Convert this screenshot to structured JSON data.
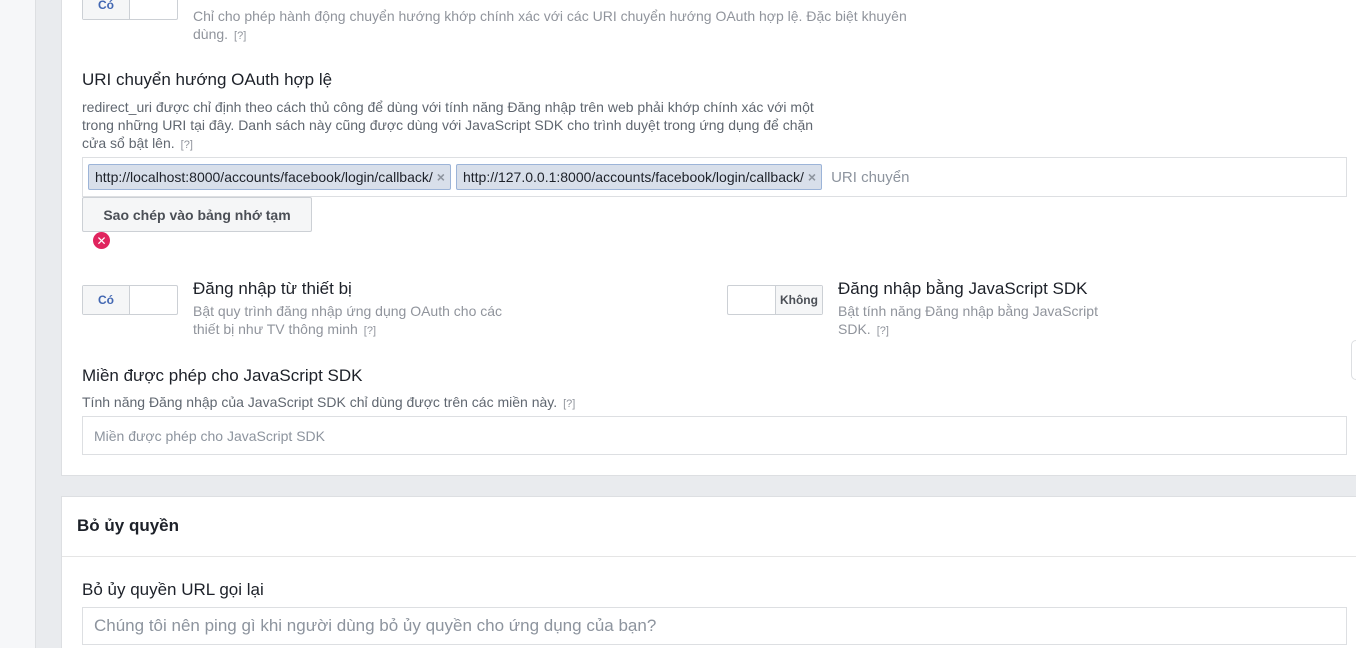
{
  "strict_mode": {
    "toggle_on_label": "Có",
    "desc": "Chỉ cho phép hành động chuyển hướng khớp chính xác với các URI chuyển hướng OAuth hợp lệ. Đặc biệt khuyên dùng."
  },
  "help_marker": "[?]",
  "redirect_uris": {
    "label": "URI chuyển hướng OAuth hợp lệ",
    "desc": "redirect_uri được chỉ định theo cách thủ công để dùng với tính năng Đăng nhập trên web phải khớp chính xác với một trong những URI tại đây. Danh sách này cũng được dùng với JavaScript SDK cho trình duyệt trong ứng dụng để chặn cửa sổ bật lên.",
    "tags": [
      "http://localhost:8000/accounts/facebook/login/callback/",
      "http://127.0.0.1:8000/accounts/facebook/login/callback/"
    ],
    "input_placeholder": "URI chuyển",
    "copy_button": "Sao chép vào bảng nhớ tạm",
    "error_icon_name": "error-x-icon"
  },
  "device_login": {
    "toggle_on_label": "Có",
    "title": "Đăng nhập từ thiết bị",
    "desc": "Bật quy trình đăng nhập ứng dụng OAuth cho các thiết bị như TV thông minh"
  },
  "js_sdk_login": {
    "toggle_off_label": "Không",
    "title": "Đăng nhập bằng JavaScript SDK",
    "desc": "Bật tính năng Đăng nhập bằng JavaScript SDK."
  },
  "js_domains": {
    "label": "Miền được phép cho JavaScript SDK",
    "desc": "Tính năng Đăng nhập của JavaScript SDK chỉ dùng được trên các miền này.",
    "placeholder": "Miền được phép cho JavaScript SDK"
  },
  "deauthorize": {
    "heading": "Bỏ ủy quyền",
    "callback_label": "Bỏ ủy quyền URL gọi lại",
    "callback_placeholder": "Chúng tôi nên ping gì khi người dùng bỏ ủy quyền cho ứng dụng của bạn?"
  },
  "colors": {
    "accent": "#4267b2",
    "tag_bg": "#d8dfea",
    "error": "#e0245e"
  }
}
